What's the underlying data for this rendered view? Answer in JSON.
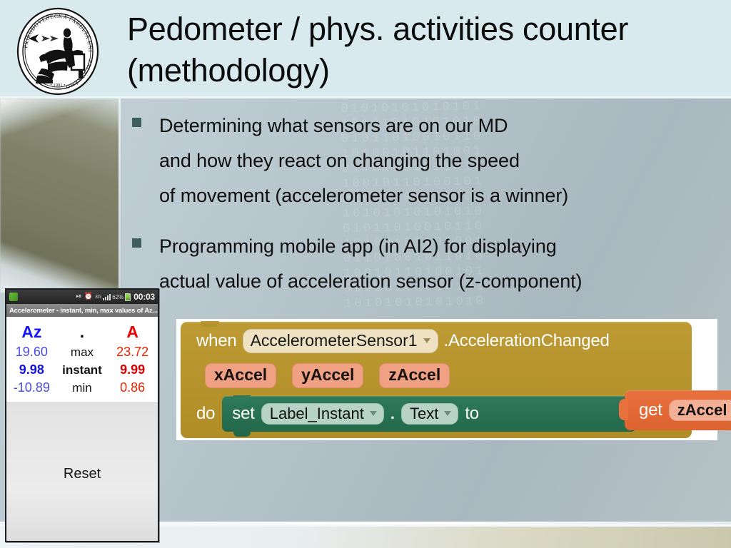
{
  "slide": {
    "title": "Pedometer / phys. activities counter (methodology)",
    "title_line1": "Pedometer / phys. activities counter",
    "title_line2": "(methodology)",
    "accent_header_bg": "#d8eaee",
    "bullet_marker_color": "#3f5e5e"
  },
  "logo": {
    "name": "palacky-university-science-faculty-seal",
    "ring_text_top": "PŘÍRODOVĚDECKÁ FAKULTA UNIVERZITY",
    "ring_text_bottom": "PALACKÉHO",
    "year": "1991"
  },
  "bullets": [
    {
      "marker": "square-bullet",
      "lines": [
        "Determining what sensors are on our MD",
        "and how they react on changing the speed",
        "of movement (accelerometer sensor is a winner)"
      ]
    },
    {
      "marker": "square-bullet",
      "lines": [
        "Programming mobile app (in AI2) for displaying",
        "actual value of acceleration sensor (z-component)"
      ]
    }
  ],
  "phone": {
    "statusbar": {
      "app_icon": "app-icon",
      "icons": [
        "mute-vibrate-icon",
        "alarm-clock-icon"
      ],
      "network": "3G",
      "network_sub": "↓↑",
      "signal": "signal-bars-icon",
      "battery_percent": "62%",
      "battery_icon": "battery-icon",
      "clock": "00:03"
    },
    "titlebar": "Accelerometer - instant, min, max values of Az...",
    "table": {
      "headers": [
        "Az",
        ".",
        "A"
      ],
      "rows": [
        {
          "az": "19.60",
          "label": "max",
          "a": "23.72"
        },
        {
          "az": "9.98",
          "label": "instant",
          "a": "9.99"
        },
        {
          "az": "-10.89",
          "label": "min",
          "a": "0.86"
        }
      ],
      "az_color": "#1414ff",
      "a_color": "#ee0000"
    },
    "reset_button": "Reset"
  },
  "ai2_blocks": {
    "event": {
      "keyword": "when",
      "component": "AccelerometerSensor1",
      "event_name": ".AccelerationChanged",
      "params": [
        "xAccel",
        "yAccel",
        "zAccel"
      ],
      "do_keyword": "do",
      "block_color": "#b8922f"
    },
    "setter": {
      "keyword": "set",
      "target": "Label_Instant",
      "dot": ".",
      "property": "Text",
      "to_keyword": "to",
      "block_color": "#2a7153"
    },
    "getter": {
      "keyword": "get",
      "variable": "zAccel",
      "block_color": "#e2692f"
    }
  },
  "background": {
    "binary_watermark": "01010101010101\n10101010101010\n01011010010110\n10100101101001\n01101001011010\n10010110100101\n01010101010101\n10101010101010\n01011010010110\n10100101101001\n01101001011010\n10010110100101\n01010101010101\n10101010101010"
  }
}
